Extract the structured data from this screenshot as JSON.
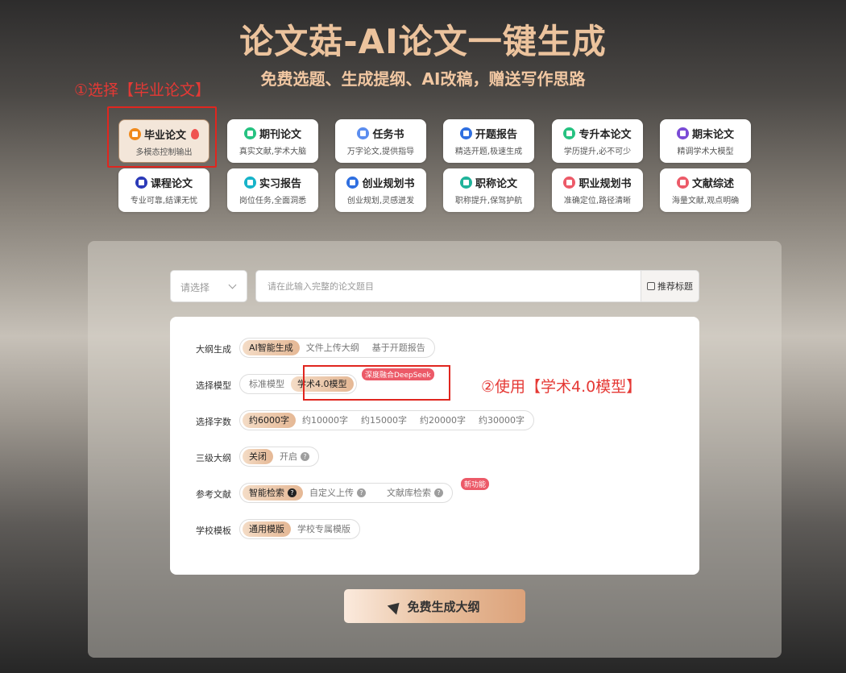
{
  "header": {
    "title": "论文菇-AI论文一键生成",
    "subtitle": "免费选题、生成提纲、AI改稿，赠送写作思路"
  },
  "annotations": {
    "step1": "①选择【毕业论文】",
    "step2": "②使用【学术4.0模型】"
  },
  "categories": [
    {
      "title": "毕业论文",
      "desc": "多模态控制输出",
      "icon": "graduation-icon",
      "color": "#f08a1c",
      "active": true,
      "hot": true
    },
    {
      "title": "期刊论文",
      "desc": "真实文献,学术大脑",
      "icon": "journal-icon",
      "color": "#26c281"
    },
    {
      "title": "任务书",
      "desc": "万字论文,提供指导",
      "icon": "task-icon",
      "color": "#5b8def"
    },
    {
      "title": "开题报告",
      "desc": "精选开题,极速生成",
      "icon": "report-icon",
      "color": "#2f6fe0"
    },
    {
      "title": "专升本论文",
      "desc": "学历提升,必不可少",
      "icon": "upgrade-icon",
      "color": "#26c281"
    },
    {
      "title": "期末论文",
      "desc": "精调学术大模型",
      "icon": "final-icon",
      "color": "#7a4bd6"
    },
    {
      "title": "课程论文",
      "desc": "专业可靠,结课无忧",
      "icon": "course-icon",
      "color": "#2b3ab8"
    },
    {
      "title": "实习报告",
      "desc": "岗位任务,全面洞悉",
      "icon": "intern-icon",
      "color": "#17b3c9"
    },
    {
      "title": "创业规划书",
      "desc": "创业规划,灵感迸发",
      "icon": "startup-icon",
      "color": "#2f6fe0"
    },
    {
      "title": "职称论文",
      "desc": "职称提升,保驾护航",
      "icon": "title-paper-icon",
      "color": "#1fb39a"
    },
    {
      "title": "职业规划书",
      "desc": "准确定位,路径清晰",
      "icon": "career-icon",
      "color": "#ec5a68"
    },
    {
      "title": "文献综述",
      "desc": "海量文献,观点明确",
      "icon": "review-icon",
      "color": "#ec5a68"
    }
  ],
  "search": {
    "select_placeholder": "请选择",
    "topic_placeholder": "请在此输入完整的论文题目",
    "recommend_label": "推荐标题"
  },
  "form": {
    "outline": {
      "label": "大纲生成",
      "options": [
        "AI智能生成",
        "文件上传大纲",
        "基于开题报告"
      ],
      "selected": 0
    },
    "model": {
      "label": "选择模型",
      "options": [
        "标准模型",
        "学术4.0模型"
      ],
      "selected": 1,
      "badge": "深度融合DeepSeek"
    },
    "words": {
      "label": "选择字数",
      "options": [
        "约6000字",
        "约10000字",
        "约15000字",
        "约20000字",
        "约30000字"
      ],
      "selected": 0
    },
    "level3": {
      "label": "三级大纲",
      "options": [
        "关闭",
        "开启"
      ],
      "selected": 0
    },
    "refs": {
      "label": "参考文献",
      "options": [
        "智能检索",
        "自定义上传",
        "文献库检索"
      ],
      "selected": 0,
      "badge": "新功能"
    },
    "template": {
      "label": "学校模板",
      "options": [
        "通用模版",
        "学校专属模版"
      ],
      "selected": 0
    }
  },
  "generate_label": "免费生成大纲"
}
